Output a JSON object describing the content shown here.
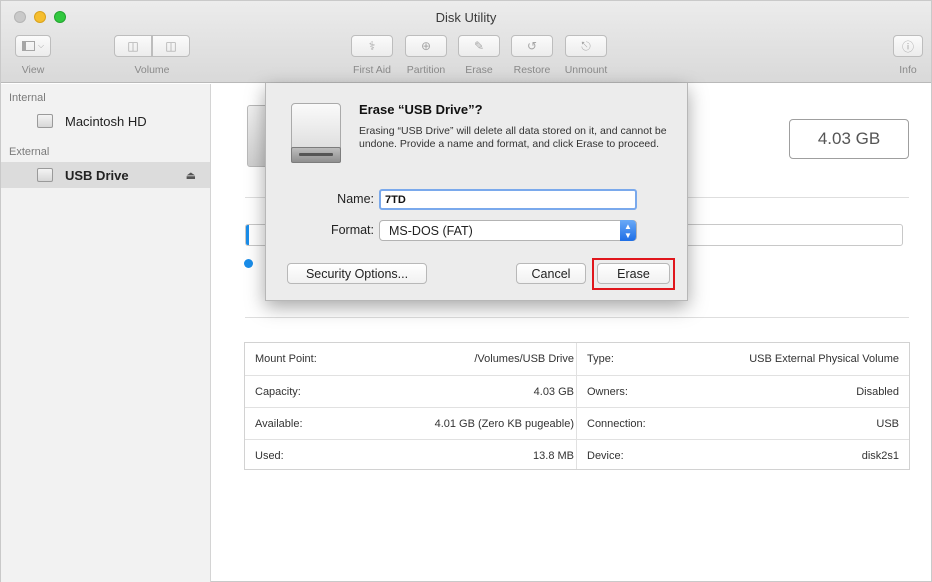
{
  "window": {
    "title": "Disk Utility"
  },
  "toolbar": {
    "view_label": "View",
    "volume_label": "Volume",
    "first_aid_label": "First Aid",
    "partition_label": "Partition",
    "erase_label": "Erase",
    "restore_label": "Restore",
    "unmount_label": "Unmount",
    "info_label": "Info"
  },
  "sidebar": {
    "internal_header": "Internal",
    "external_header": "External",
    "items": [
      {
        "label": "Macintosh HD"
      },
      {
        "label": "USB Drive"
      }
    ]
  },
  "main": {
    "capacity": "4.03 GB",
    "usage_fraction": 0.003,
    "info": {
      "rows": [
        {
          "k1": "Mount Point:",
          "v1": "/Volumes/USB Drive",
          "k2": "Type:",
          "v2": "USB External Physical Volume"
        },
        {
          "k1": "Capacity:",
          "v1": "4.03 GB",
          "k2": "Owners:",
          "v2": "Disabled"
        },
        {
          "k1": "Available:",
          "v1": "4.01 GB (Zero KB pugeable)",
          "k2": "Connection:",
          "v2": "USB"
        },
        {
          "k1": "Used:",
          "v1": "13.8 MB",
          "k2": "Device:",
          "v2": "disk2s1"
        }
      ]
    }
  },
  "dialog": {
    "title": "Erase “USB Drive”?",
    "message": "Erasing “USB Drive” will delete all data stored on it, and cannot be undone. Provide a name and format, and click Erase to proceed.",
    "name_label": "Name:",
    "name_value": "7TD",
    "format_label": "Format:",
    "format_value": "MS-DOS (FAT)",
    "security_button": "Security Options...",
    "cancel_button": "Cancel",
    "erase_button": "Erase",
    "highlight_color": "#e0161c"
  },
  "colors": {
    "accent": "#1a8de9"
  }
}
